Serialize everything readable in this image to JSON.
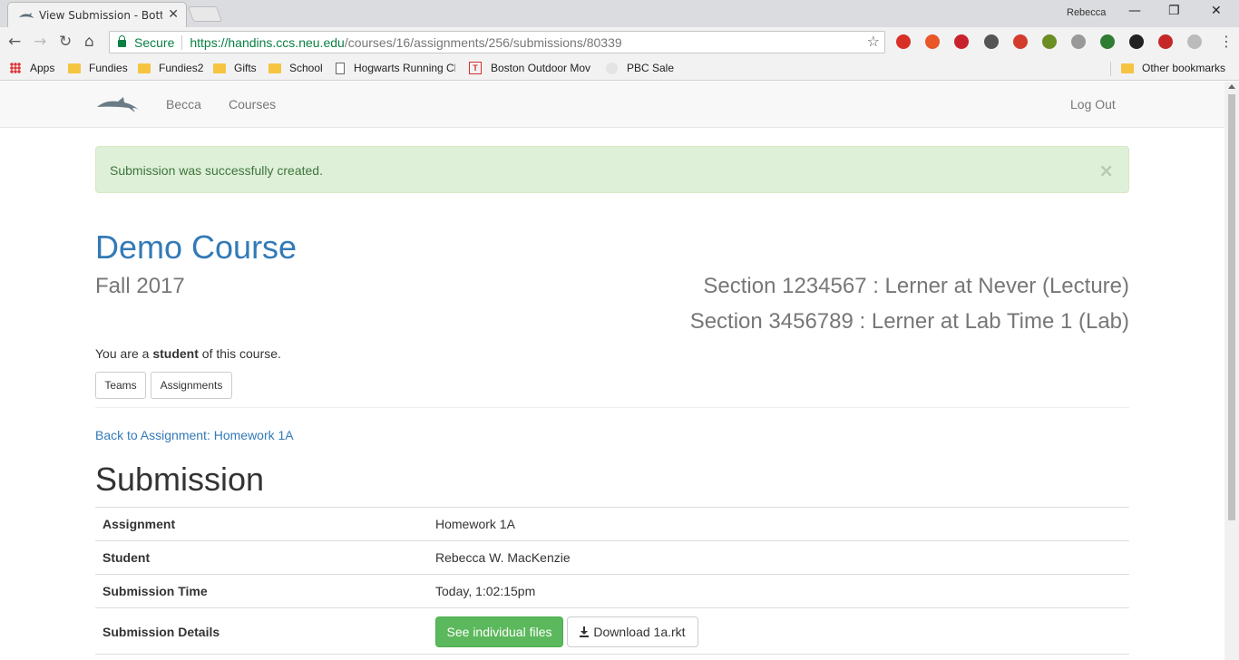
{
  "browser": {
    "tab_title": "View Submission - Bottle",
    "tab_close": "✕",
    "profile": "Rebecca",
    "window_controls": {
      "minimize": "—",
      "restore": "❐",
      "close": "✕"
    },
    "secure_label": "Secure",
    "url_host": "https://handins.ccs.neu.edu",
    "url_path": "/courses/16/assignments/256/submissions/80339",
    "nav": {
      "back": "←",
      "forward": "→",
      "reload": "↻",
      "home": "⌂",
      "star": "☆",
      "menu": "⋮"
    },
    "bookmarks": [
      {
        "label": "Apps",
        "icon": "apps-grid-icon"
      },
      {
        "label": "Fundies",
        "icon": "folder-icon"
      },
      {
        "label": "Fundies2",
        "icon": "folder-icon"
      },
      {
        "label": "Gifts",
        "icon": "folder-icon"
      },
      {
        "label": "School",
        "icon": "folder-icon"
      },
      {
        "label": "Hogwarts Running Cl",
        "icon": "page-icon"
      },
      {
        "label": "Boston Outdoor Mov",
        "icon": "t-logo-icon"
      },
      {
        "label": "PBC Sale",
        "icon": "page-icon"
      }
    ],
    "other_bookmarks": "Other bookmarks",
    "extension_colors": [
      "#d93025",
      "#e8562a",
      "#c8232c",
      "#555555",
      "#d33b2c",
      "#6b8e23",
      "#999999",
      "#2e7d32",
      "#222222",
      "#c62828",
      "#bbbbbb"
    ]
  },
  "nav": {
    "brand_icon": "dolphin-logo-icon",
    "user": "Becca",
    "courses": "Courses",
    "logout": "Log Out"
  },
  "alert": {
    "message": "Submission was successfully created.",
    "close": "×"
  },
  "course": {
    "title": "Demo Course",
    "term": "Fall 2017",
    "sections": [
      "Section 1234567 : Lerner at Never (Lecture)",
      "Section 3456789 : Lerner at Lab Time 1 (Lab)"
    ],
    "role_prefix": "You are a ",
    "role": "student",
    "role_suffix": " of this course.",
    "teams_button": "Teams",
    "assignments_button": "Assignments"
  },
  "back_link": "Back to Assignment: Homework 1A",
  "submission": {
    "heading": "Submission",
    "rows": [
      {
        "key": "Assignment",
        "value": "Homework 1A"
      },
      {
        "key": "Student",
        "value": "Rebecca W. MacKenzie"
      },
      {
        "key": "Submission Time",
        "value": "Today, 1:02:15pm"
      },
      {
        "key": "Submission Details"
      }
    ],
    "see_files_button": "See individual files",
    "download_button": "Download 1a.rkt"
  },
  "colors": {
    "link": "#337ab7",
    "success": "#5cb85c",
    "alert_bg": "#dff0d8",
    "alert_text": "#3c763d"
  }
}
